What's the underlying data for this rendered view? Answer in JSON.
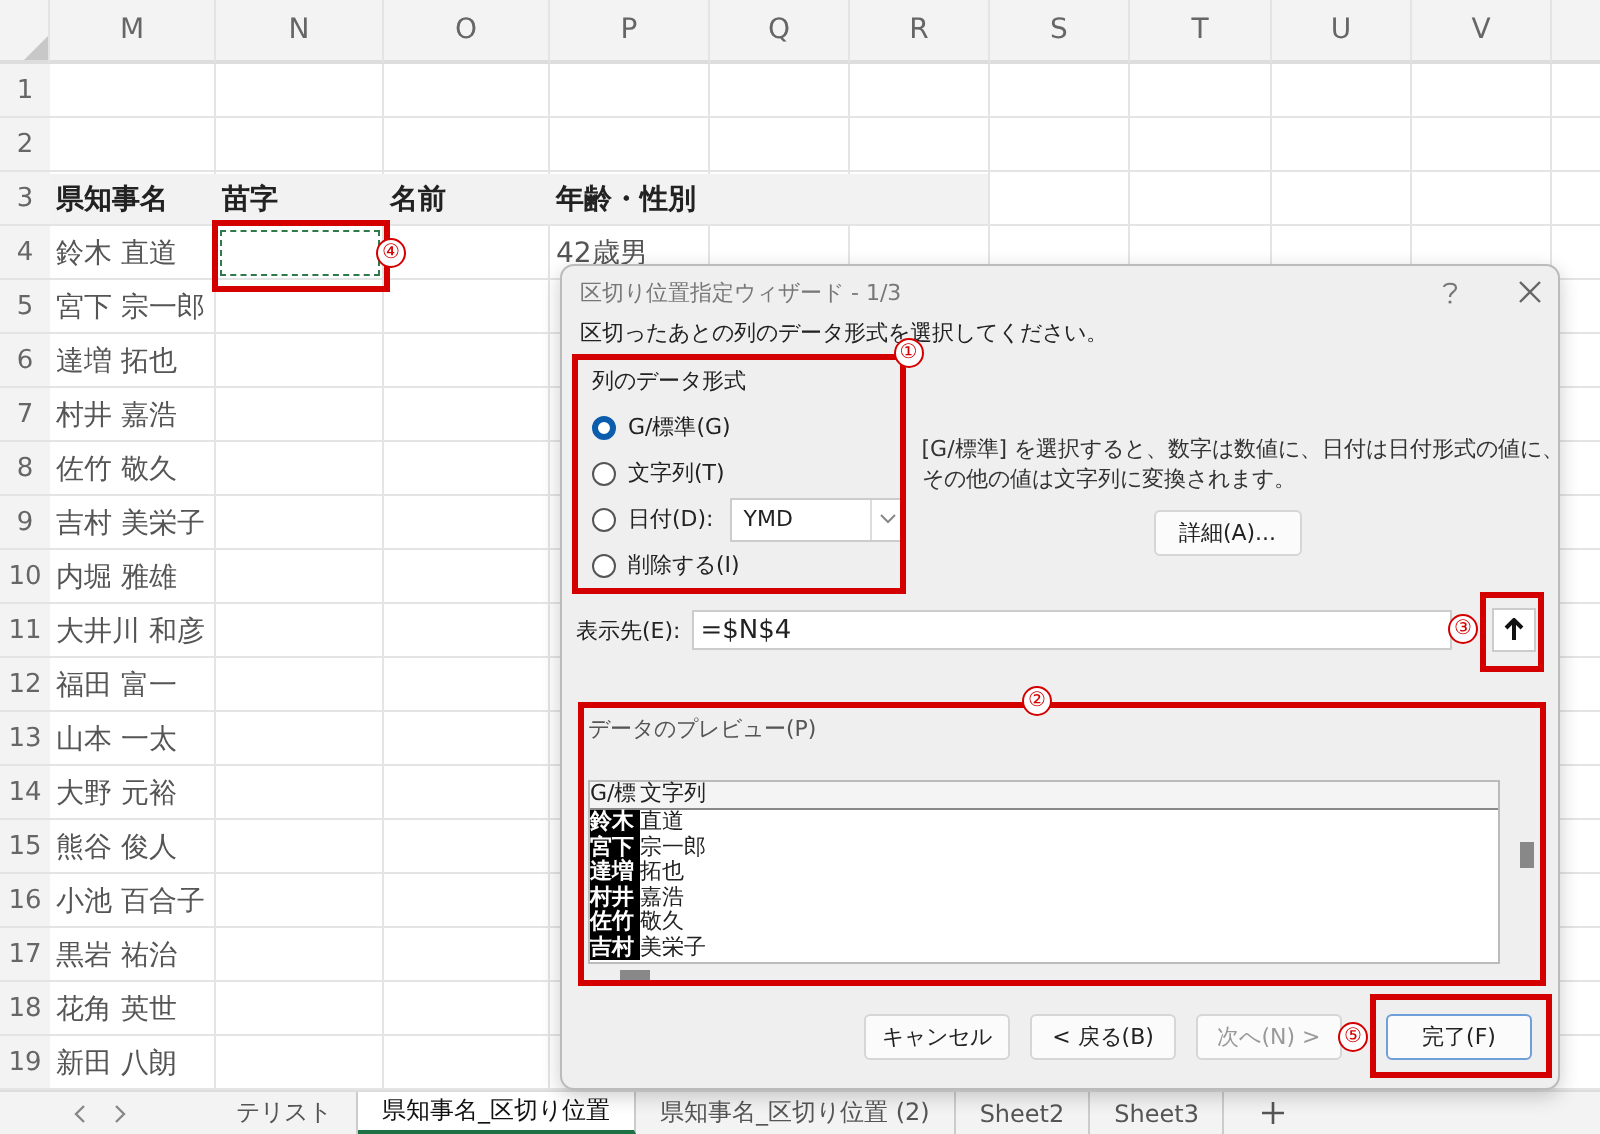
{
  "sheet": {
    "columns": [
      "M",
      "N",
      "O",
      "P",
      "Q",
      "R",
      "S",
      "T",
      "U",
      "V"
    ],
    "rows": [
      {
        "number": "1"
      },
      {
        "number": "2"
      },
      {
        "number": "3",
        "heading": true,
        "cells": [
          "県知事名",
          "苗字",
          "名前",
          "年齢・性別"
        ]
      },
      {
        "number": "4",
        "cells": [
          "鈴木 直道",
          null,
          null,
          "42歳男"
        ],
        "annotation": "④"
      },
      {
        "number": "5",
        "cells": [
          "宮下 宗一郎"
        ]
      },
      {
        "number": "6",
        "cells": [
          "達増 拓也"
        ]
      },
      {
        "number": "7",
        "cells": [
          "村井 嘉浩"
        ]
      },
      {
        "number": "8",
        "cells": [
          "佐竹 敬久"
        ]
      },
      {
        "number": "9",
        "cells": [
          "吉村 美栄子"
        ]
      },
      {
        "number": "10",
        "cells": [
          "内堀 雅雄"
        ]
      },
      {
        "number": "11",
        "cells": [
          "大井川 和彦"
        ]
      },
      {
        "number": "12",
        "cells": [
          "福田 富一"
        ]
      },
      {
        "number": "13",
        "cells": [
          "山本 一太"
        ]
      },
      {
        "number": "14",
        "cells": [
          "大野 元裕"
        ]
      },
      {
        "number": "15",
        "cells": [
          "熊谷 俊人"
        ]
      },
      {
        "number": "16",
        "cells": [
          "小池 百合子"
        ]
      },
      {
        "number": "17",
        "cells": [
          "黒岩 祐治"
        ]
      },
      {
        "number": "18",
        "cells": [
          "花角 英世"
        ]
      },
      {
        "number": "19",
        "cells": [
          "新田 八朗"
        ]
      }
    ]
  },
  "dialog": {
    "title": "区切り位置指定ウィザード - 1/3",
    "instruction": "区切ったあとの列のデータ形式を選択してください。",
    "format_group": {
      "label": "列のデータ形式",
      "annotation": "①",
      "options": [
        {
          "label": "G/標準(G)",
          "selected": true
        },
        {
          "label": "文字列(T)",
          "selected": false
        },
        {
          "label": "日付(D):",
          "selected": false,
          "dropdown": "YMD"
        },
        {
          "label": "削除する(I)",
          "selected": false
        }
      ]
    },
    "description": [
      "[G/標準] を選択すると、数字は数値に、日付は日付形式の値に、",
      "その他の値は文字列に変換されます。"
    ],
    "advanced_button": "詳細(A)...",
    "destination": {
      "label": "表示先(E):",
      "value": "=$N$4",
      "annotation": "③"
    },
    "preview": {
      "label": "データのプレビュー(P)",
      "annotation": "②",
      "columns": [
        {
          "label": "G/標",
          "selected": true,
          "values": [
            "鈴木",
            "宮下",
            "達増",
            "村井",
            "佐竹",
            "吉村"
          ]
        },
        {
          "label": "文字列",
          "selected": false,
          "values": [
            "直道",
            "宗一郎",
            "拓也",
            "嘉浩",
            "敬久",
            "美栄子"
          ]
        }
      ]
    },
    "buttons": [
      {
        "label": "キャンセル",
        "kind": "normal",
        "disabled": false
      },
      {
        "label": "< 戻る(B)",
        "kind": "normal",
        "disabled": false
      },
      {
        "label": "次へ(N) >",
        "kind": "normal",
        "disabled": true
      },
      {
        "label": "完了(F)",
        "kind": "default",
        "disabled": false,
        "annotation": "⑤"
      }
    ]
  },
  "sheet_tabs": [
    {
      "label": "テリスト",
      "selected": false
    },
    {
      "label": "県知事名_区切り位置",
      "selected": true
    },
    {
      "label": "県知事名_区切り位置 (2)",
      "selected": false
    },
    {
      "label": "Sheet2",
      "selected": false
    },
    {
      "label": "Sheet3",
      "selected": false
    }
  ]
}
